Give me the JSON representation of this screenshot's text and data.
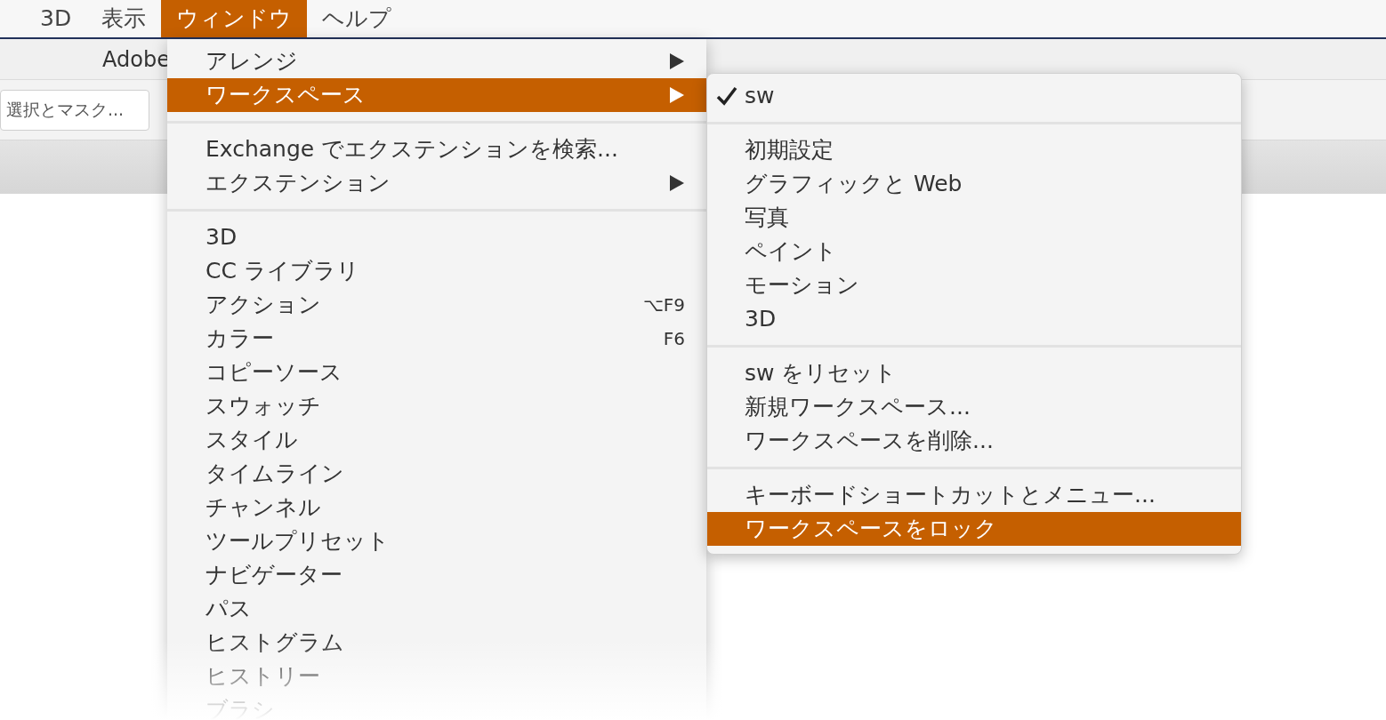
{
  "menubar": [
    {
      "label": "3D",
      "selected": false
    },
    {
      "label": "表示",
      "selected": false
    },
    {
      "label": "ウィンドウ",
      "selected": true
    },
    {
      "label": "ヘルプ",
      "selected": false
    }
  ],
  "toolbar": {
    "title": "Adobe",
    "button": "選択とマスク..."
  },
  "window_menu": {
    "groups": [
      [
        {
          "label": "アレンジ",
          "submenu": true,
          "selected": false
        },
        {
          "label": "ワークスペース",
          "submenu": true,
          "selected": true
        }
      ],
      [
        {
          "label": "Exchange でエクステンションを検索...",
          "submenu": false,
          "selected": false
        },
        {
          "label": "エクステンション",
          "submenu": true,
          "selected": false
        }
      ],
      [
        {
          "label": "3D",
          "submenu": false,
          "selected": false
        },
        {
          "label": "CC ライブラリ",
          "submenu": false,
          "selected": false
        },
        {
          "label": "アクション",
          "submenu": false,
          "selected": false,
          "shortcut": "⌥F9"
        },
        {
          "label": "カラー",
          "submenu": false,
          "selected": false,
          "shortcut": "F6"
        },
        {
          "label": "コピーソース",
          "submenu": false,
          "selected": false
        },
        {
          "label": "スウォッチ",
          "submenu": false,
          "selected": false
        },
        {
          "label": "スタイル",
          "submenu": false,
          "selected": false
        },
        {
          "label": "タイムライン",
          "submenu": false,
          "selected": false
        },
        {
          "label": "チャンネル",
          "submenu": false,
          "selected": false
        },
        {
          "label": "ツールプリセット",
          "submenu": false,
          "selected": false
        },
        {
          "label": "ナビゲーター",
          "submenu": false,
          "selected": false
        },
        {
          "label": "パス",
          "submenu": false,
          "selected": false
        },
        {
          "label": "ヒストグラム",
          "submenu": false,
          "selected": false
        },
        {
          "label": "ヒストリー",
          "submenu": false,
          "selected": false
        },
        {
          "label": "ブラシ",
          "submenu": false,
          "selected": false
        }
      ]
    ]
  },
  "workspace_menu": {
    "groups": [
      [
        {
          "label": "sw",
          "checked": true,
          "selected": false
        }
      ],
      [
        {
          "label": "初期設定",
          "checked": false,
          "selected": false
        },
        {
          "label": "グラフィックと Web",
          "checked": false,
          "selected": false
        },
        {
          "label": "写真",
          "checked": false,
          "selected": false
        },
        {
          "label": "ペイント",
          "checked": false,
          "selected": false
        },
        {
          "label": "モーション",
          "checked": false,
          "selected": false
        },
        {
          "label": "3D",
          "checked": false,
          "selected": false
        }
      ],
      [
        {
          "label": "sw をリセット",
          "checked": false,
          "selected": false
        },
        {
          "label": "新規ワークスペース...",
          "checked": false,
          "selected": false
        },
        {
          "label": "ワークスペースを削除...",
          "checked": false,
          "selected": false
        }
      ],
      [
        {
          "label": "キーボードショートカットとメニュー...",
          "checked": false,
          "selected": false
        },
        {
          "label": "ワークスペースをロック",
          "checked": false,
          "selected": true
        }
      ]
    ]
  }
}
